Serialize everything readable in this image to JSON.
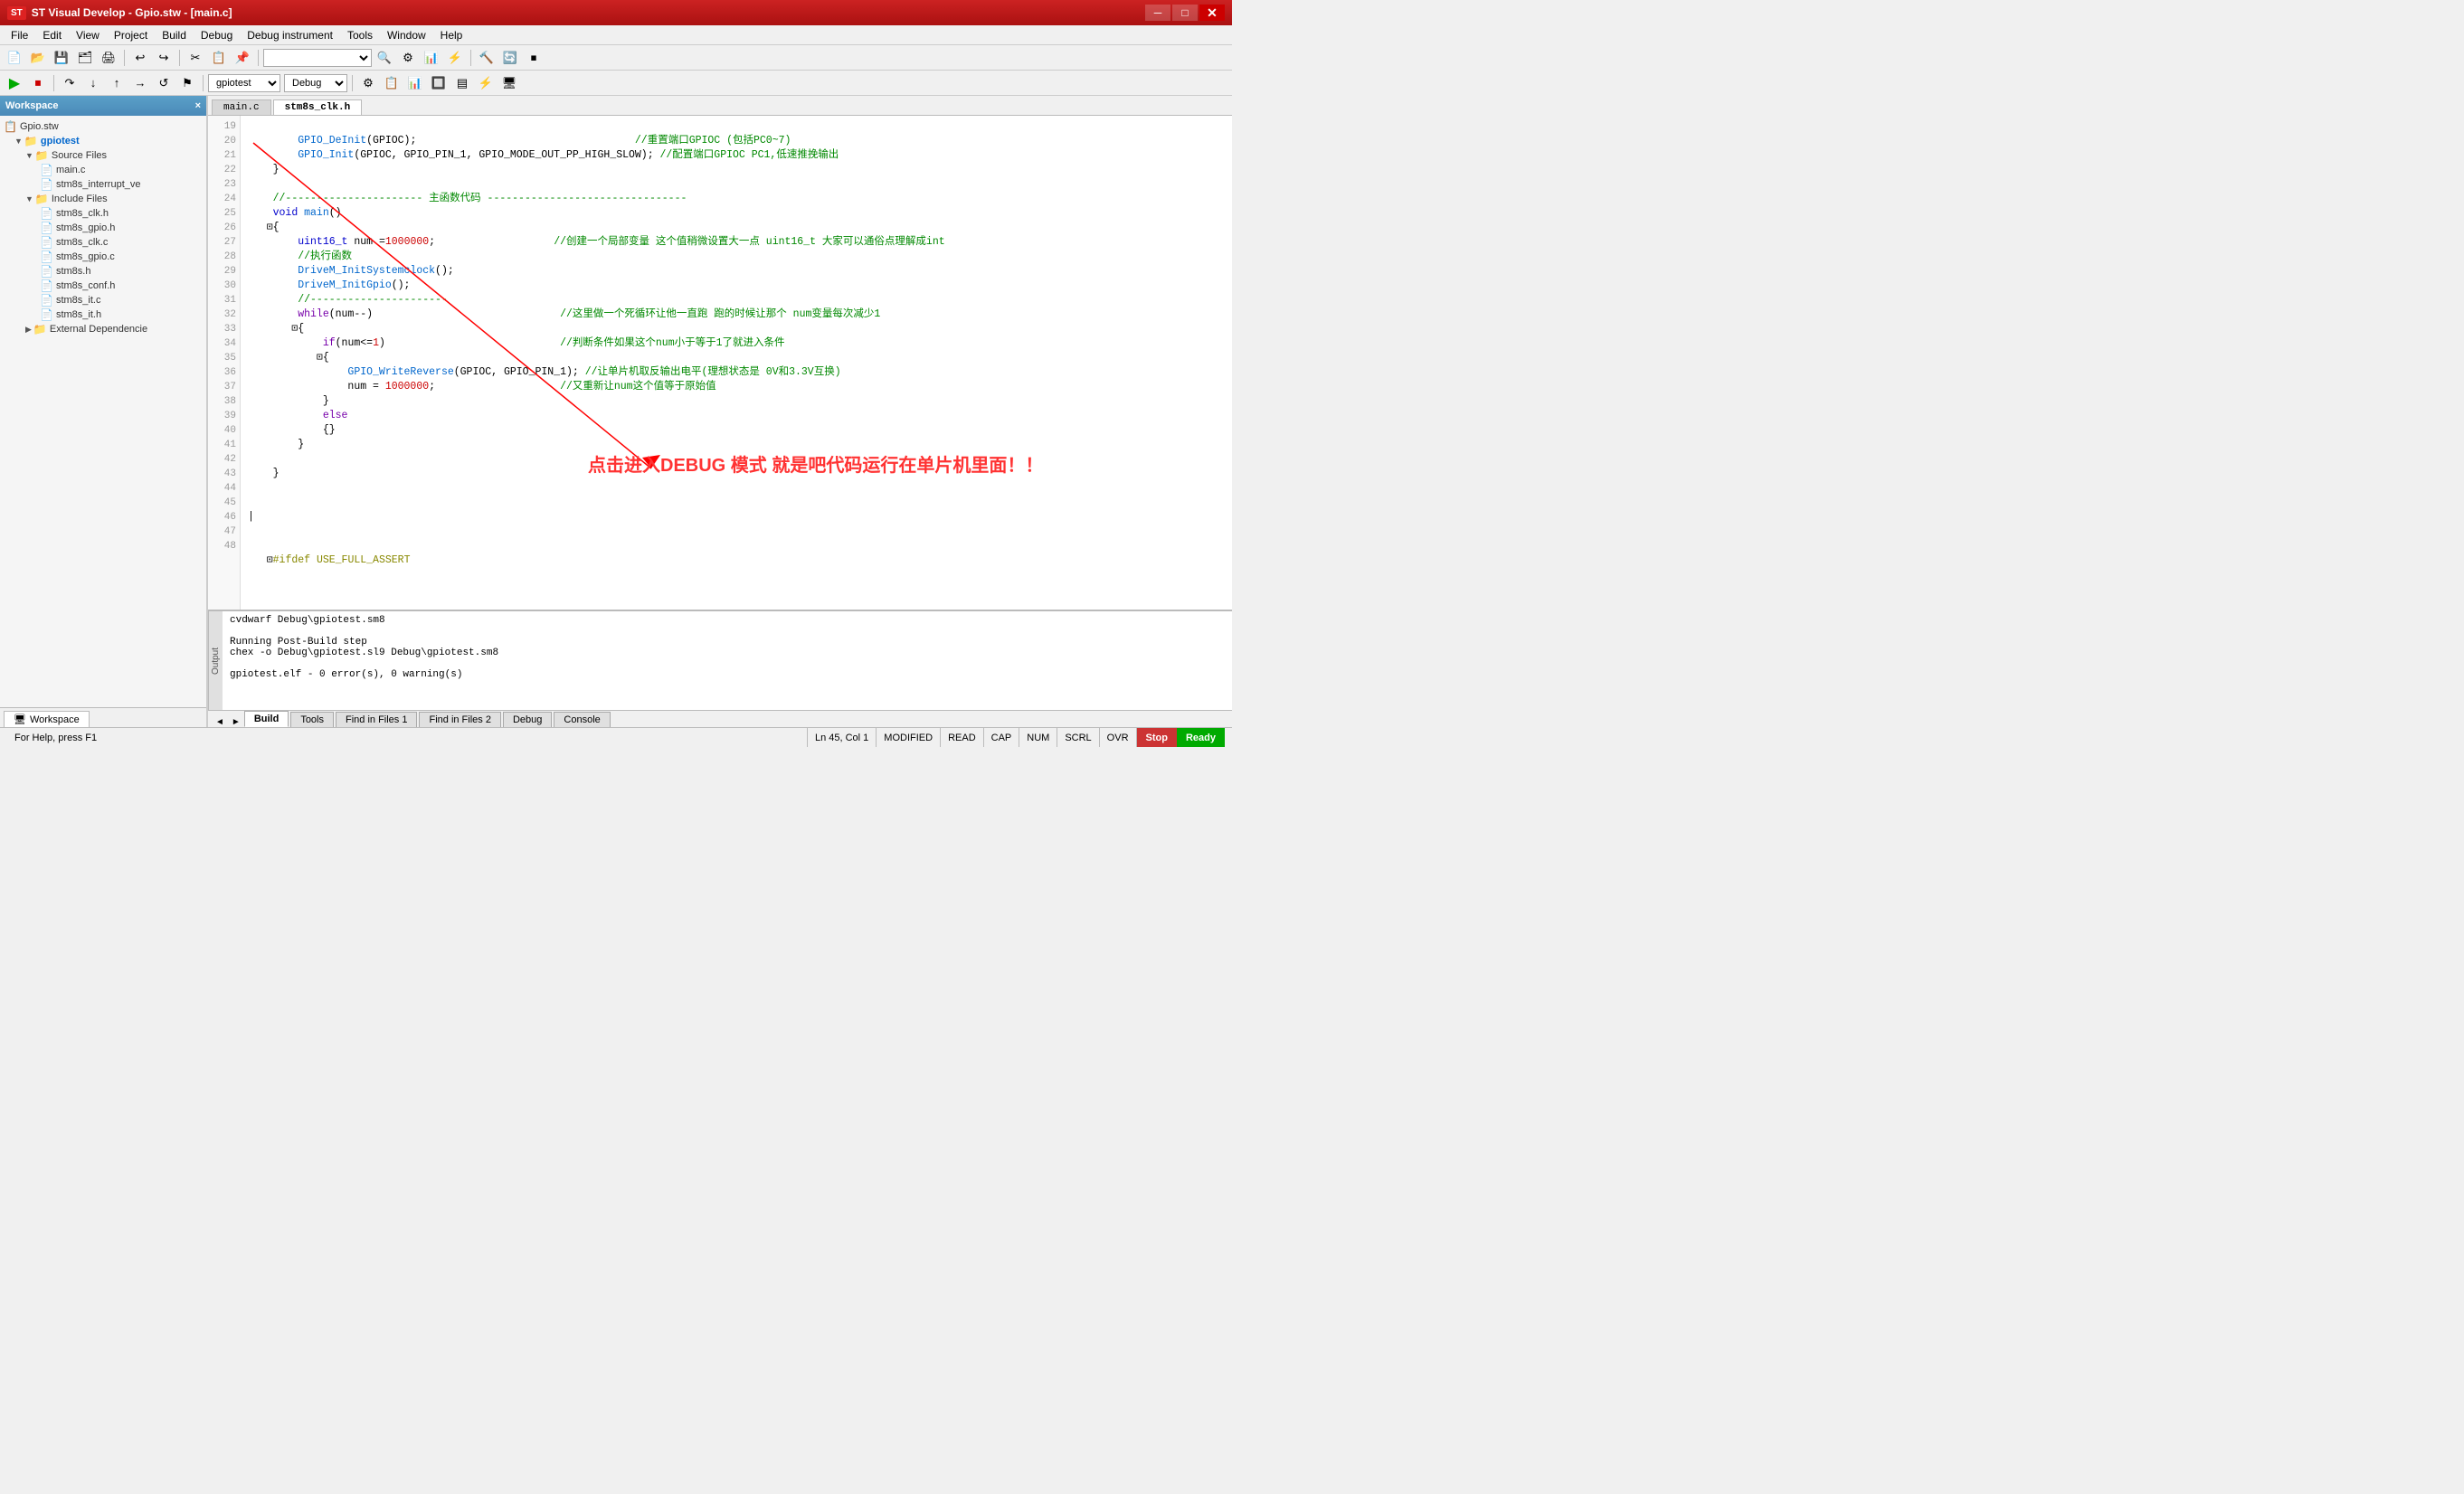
{
  "window": {
    "title": "ST Visual Develop - Gpio.stw - [main.c]",
    "icon": "ST"
  },
  "menu": {
    "items": [
      "File",
      "Edit",
      "View",
      "Project",
      "Build",
      "Debug",
      "Debug instrument",
      "Tools",
      "Window",
      "Help"
    ]
  },
  "toolbar1": {
    "buttons": [
      "new",
      "open",
      "save",
      "saveall",
      "print",
      "undo",
      "redo",
      "cut",
      "copy",
      "paste",
      "find",
      "build",
      "rebuild",
      "stop"
    ],
    "dropdown_value": "",
    "dropdown_placeholder": ""
  },
  "toolbar2": {
    "buttons": [
      "debug-start",
      "debug-stop",
      "step-over",
      "step-into",
      "step-out"
    ],
    "project_dropdown": "gpiotest",
    "config_dropdown": "Debug"
  },
  "sidebar": {
    "title": "Workspace",
    "close_btn": "×",
    "tree": [
      {
        "indent": 0,
        "icon": "📋",
        "label": "Gpio.stw",
        "arrow": "",
        "bold": false
      },
      {
        "indent": 1,
        "icon": "📁",
        "label": "gpiotest",
        "arrow": "▼",
        "bold": true,
        "blue": true
      },
      {
        "indent": 2,
        "icon": "📁",
        "label": "Source Files",
        "arrow": "▼"
      },
      {
        "indent": 3,
        "icon": "📄",
        "label": "main.c",
        "arrow": ""
      },
      {
        "indent": 3,
        "icon": "📄",
        "label": "stm8s_interrupt_ve",
        "arrow": ""
      },
      {
        "indent": 2,
        "icon": "📁",
        "label": "Include Files",
        "arrow": "▼"
      },
      {
        "indent": 3,
        "icon": "📄",
        "label": "stm8s_clk.h",
        "arrow": ""
      },
      {
        "indent": 3,
        "icon": "📄",
        "label": "stm8s_gpio.h",
        "arrow": ""
      },
      {
        "indent": 3,
        "icon": "📄",
        "label": "stm8s_clk.c",
        "arrow": ""
      },
      {
        "indent": 3,
        "icon": "📄",
        "label": "stm8s_gpio.c",
        "arrow": ""
      },
      {
        "indent": 3,
        "icon": "📄",
        "label": "stm8s.h",
        "arrow": ""
      },
      {
        "indent": 3,
        "icon": "📄",
        "label": "stm8s_conf.h",
        "arrow": ""
      },
      {
        "indent": 3,
        "icon": "📄",
        "label": "stm8s_it.c",
        "arrow": ""
      },
      {
        "indent": 3,
        "icon": "📄",
        "label": "stm8s_it.h",
        "arrow": ""
      },
      {
        "indent": 2,
        "icon": "📁",
        "label": "External Dependencie",
        "arrow": "▶"
      }
    ],
    "workspace_tab": "Workspace"
  },
  "editor": {
    "tabs": [
      {
        "label": "main.c",
        "active": false
      },
      {
        "label": "stm8s_clk.h",
        "active": true
      }
    ],
    "lines": [
      {
        "num": 19,
        "code": "        GPIO_DeInit(GPIOC);",
        "comment": "//重置端口GPIOC (包括PC0~7)"
      },
      {
        "num": 20,
        "code": "        GPIO_Init(GPIOC, GPIO_PIN_1, GPIO_MODE_OUT_PP_HIGH_SLOW);",
        "comment": "//配置端口GPIOC PC1,低速推挽输出"
      },
      {
        "num": 21,
        "code": "    }",
        "comment": ""
      },
      {
        "num": 22,
        "code": "",
        "comment": ""
      },
      {
        "num": 23,
        "code": "    //---------------------- 主函数代码 --------------------------------",
        "comment": ""
      },
      {
        "num": 24,
        "code": "    void main()",
        "comment": ""
      },
      {
        "num": 25,
        "code": "   ⊡{",
        "comment": ""
      },
      {
        "num": 26,
        "code": "        uint16_t num =1000000;",
        "comment": "//创建一个局部变量 这个值稍微设置大一点 uint16_t 大家可以通俗点理解成int"
      },
      {
        "num": 27,
        "code": "        //执行函数",
        "comment": ""
      },
      {
        "num": 28,
        "code": "        DriveM_InitSystemclock();",
        "comment": ""
      },
      {
        "num": 29,
        "code": "        DriveM_InitGpio();",
        "comment": ""
      },
      {
        "num": 30,
        "code": "        //----------------------",
        "comment": ""
      },
      {
        "num": 31,
        "code": "        while(num--)",
        "comment": "//这里做一个死循环让他一直跑 跑的时候让那个 num变量每次减少1"
      },
      {
        "num": 32,
        "code": "       ⊡{",
        "comment": ""
      },
      {
        "num": 33,
        "code": "            if(num<=1)",
        "comment": "//判断条件如果这个num小于等于1了就进入条件"
      },
      {
        "num": 34,
        "code": "           ⊡{",
        "comment": ""
      },
      {
        "num": 35,
        "code": "                GPIO_WriteReverse(GPIOC, GPIO_PIN_1);",
        "comment": "//让单片机取反输出电平(理想状态是 0V和3.3V互换)"
      },
      {
        "num": 36,
        "code": "                num = 1000000;",
        "comment": "//又重新让num这个值等于原始值"
      },
      {
        "num": 37,
        "code": "            }",
        "comment": ""
      },
      {
        "num": 38,
        "code": "            else",
        "comment": ""
      },
      {
        "num": 39,
        "code": "            {}",
        "comment": ""
      },
      {
        "num": 40,
        "code": "        }",
        "comment": ""
      },
      {
        "num": 41,
        "code": "",
        "comment": ""
      },
      {
        "num": 42,
        "code": "    }",
        "comment": ""
      },
      {
        "num": 43,
        "code": "",
        "comment": ""
      },
      {
        "num": 44,
        "code": "",
        "comment": ""
      },
      {
        "num": 45,
        "code": "|",
        "comment": ""
      },
      {
        "num": 46,
        "code": "",
        "comment": ""
      },
      {
        "num": 47,
        "code": "",
        "comment": ""
      },
      {
        "num": 48,
        "code": "   ⊡#ifdef USE_FULL_ASSERT",
        "comment": ""
      }
    ],
    "annotation_text": "点击进入DEBUG 模式 就是吧代码运行在单片机里面！！"
  },
  "output_panel": {
    "label": "Output",
    "lines": [
      "cvdwarf Debug\\gpiotest.sm8",
      "",
      "Running Post-Build step",
      "chex -o Debug\\gpiotest.sl9 Debug\\gpiotest.sm8",
      "",
      "gpiotest.elf - 0 error(s), 0 warning(s)"
    ],
    "tabs": [
      {
        "label": "Build",
        "active": true
      },
      {
        "label": "Tools",
        "active": false
      },
      {
        "label": "Find in Files 1",
        "active": false
      },
      {
        "label": "Find in Files 2",
        "active": false
      },
      {
        "label": "Debug",
        "active": false
      },
      {
        "label": "Console",
        "active": false
      }
    ]
  },
  "status_bar": {
    "help_text": "For Help, press F1",
    "position": "Ln 45, Col 1",
    "modified": "MODIFIED",
    "read": "READ",
    "cap": "CAP",
    "num": "NUM",
    "scrl": "SCRL",
    "ovr": "OVR",
    "stop_label": "Stop",
    "ready_label": "Ready",
    "stop_color": "#cc0000",
    "ready_color": "#00aa00"
  }
}
